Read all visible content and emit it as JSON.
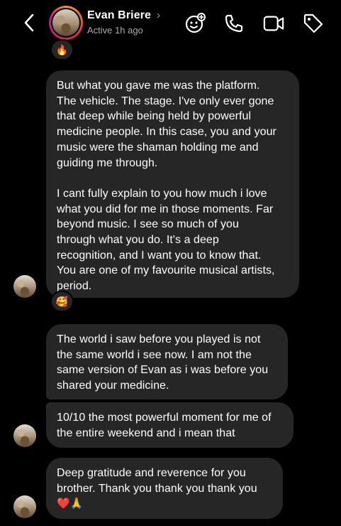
{
  "header": {
    "name": "Evan Briere",
    "status": "Active 1h ago",
    "chevron": "›",
    "icons": [
      "back-chevron-icon",
      "effects-icon",
      "phone-icon",
      "video-icon",
      "tag-icon"
    ]
  },
  "reactions": {
    "top": "🔥",
    "after_first": "🥰"
  },
  "messages": [
    {
      "lines": [
        "But what you gave me was the platform.",
        "The vehicle. The stage. I've only ever gone",
        "that deep while being held by powerful",
        "medicine people. In this case, you and your",
        "music were the shaman holding me and",
        "guiding me through.",
        "",
        "I cant fully explain to you how much i love",
        "what you did for me in those moments. Far",
        "beyond music. I see so much of you",
        "through what you do. It's a deep",
        "recognition, and I want you to know that.",
        "You are one of my favourite musical artists,",
        "period."
      ]
    },
    {
      "lines": [
        "The world i saw before you played is not",
        "the same world i see now. I am not the",
        "same version of Evan as i was before you",
        "shared your medicine."
      ]
    },
    {
      "lines": [
        "10/10 the most powerful moment for me of",
        "the entire weekend and i mean that"
      ]
    },
    {
      "lines": [
        "Deep gratitude and reverence for you",
        "brother. Thank you thank you thank you",
        "❤️🙏"
      ]
    }
  ],
  "colors": {
    "background": "#000000",
    "bubble": "#262626",
    "secondary_text": "#a8a8a8"
  }
}
